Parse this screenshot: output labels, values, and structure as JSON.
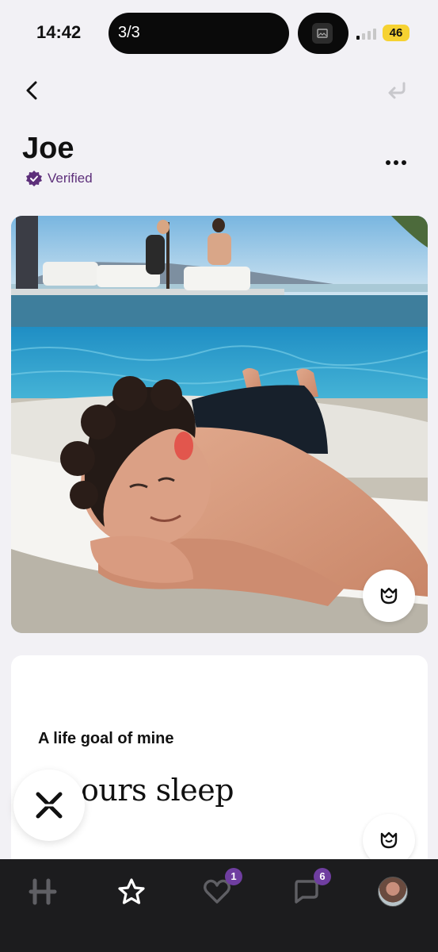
{
  "status_bar": {
    "time": "14:42",
    "activity_label": "3/3",
    "battery": "46"
  },
  "profile": {
    "name": "Joe",
    "verified_label": "Verified"
  },
  "prompt": {
    "question": "A life goal of mine",
    "answer": "ours sleep"
  },
  "tab_bar": {
    "likes_badge": "1",
    "messages_badge": "6"
  },
  "colors": {
    "accent_purple": "#5d2f7a",
    "badge_purple": "#6f3ea0",
    "battery_yellow": "#f6d232",
    "tab_bar_bg": "#1c1c1e"
  },
  "icons": [
    "back-icon",
    "undo-icon",
    "verified-badge-icon",
    "more-icon",
    "rose-icon",
    "skip-icon",
    "hinge-home-icon",
    "star-icon",
    "heart-icon",
    "chat-icon"
  ]
}
